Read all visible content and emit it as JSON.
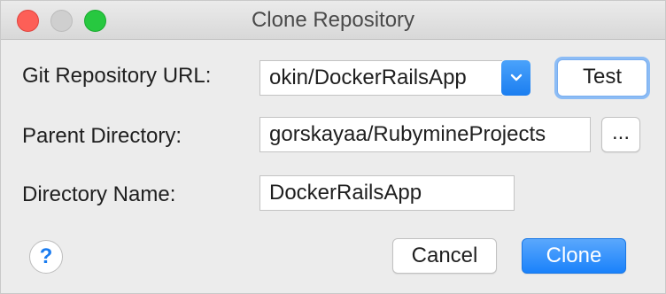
{
  "window": {
    "title": "Clone Repository"
  },
  "colors": {
    "accent": "#1a82fb",
    "close": "#fd5f57",
    "maximize": "#27c840"
  },
  "form": {
    "git_url_label": "Git Repository URL:",
    "git_url_value": "okin/DockerRailsApp",
    "test_label": "Test",
    "parent_dir_label": "Parent Directory:",
    "parent_dir_value": "gorskayaa/RubymineProjects",
    "browse_label": "...",
    "dir_name_label": "Directory Name:",
    "dir_name_value": "DockerRailsApp"
  },
  "footer": {
    "help_label": "?",
    "cancel_label": "Cancel",
    "clone_label": "Clone"
  }
}
